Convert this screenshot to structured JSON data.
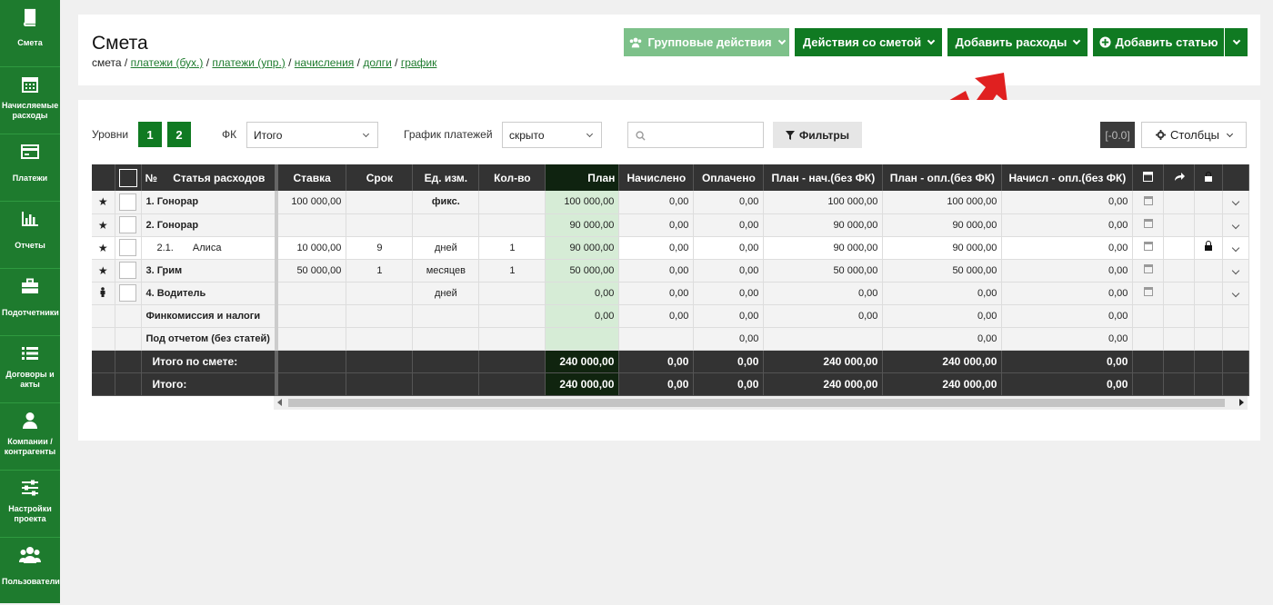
{
  "sidebar": {
    "items": [
      {
        "label": "Смета",
        "icon": "book-icon"
      },
      {
        "label": "Начисляемые расходы",
        "icon": "calendar-icon"
      },
      {
        "label": "Платежи",
        "icon": "card-icon"
      },
      {
        "label": "Отчеты",
        "icon": "bar-chart-icon"
      },
      {
        "label": "Подотчетники",
        "icon": "briefcase-icon"
      },
      {
        "label": "Договоры и акты",
        "icon": "list-icon"
      },
      {
        "label": "Компании / контрагенты",
        "icon": "user-icon"
      },
      {
        "label": "Настройки проекта",
        "icon": "sliders-icon"
      },
      {
        "label": "Пользователи",
        "icon": "users-icon"
      }
    ]
  },
  "header": {
    "title": "Смета",
    "breadcrumb_root": "смета",
    "breadcrumb_links": [
      "платежи (бух.)",
      "платежи (упр.)",
      "начисления",
      "долги",
      "график"
    ],
    "buttons": {
      "group_actions": "Групповые действия",
      "estimate_actions": "Действия со сметой",
      "add_expenses": "Добавить расходы",
      "add_item": "Добавить статью"
    }
  },
  "toolbar": {
    "levels_label": "Уровни",
    "levels": [
      "1",
      "2"
    ],
    "fk_label": "ФК",
    "fk_value": "Итого",
    "schedule_label": "График платежей",
    "schedule_value": "скрыто",
    "search_placeholder": "",
    "filters_label": "Фильтры",
    "zero_badge": "[-0.0]",
    "columns_label": "Столбцы"
  },
  "table": {
    "headers": {
      "num": "№",
      "item": "Статья расходов",
      "rate": "Ставка",
      "term": "Срок",
      "unit": "Ед. изм.",
      "qty": "Кол-во",
      "plan": "План",
      "accrued": "Начислено",
      "paid": "Оплачено",
      "plan_acc": "План - нач.(без ФК)",
      "plan_paid": "План - опл.(без ФК)",
      "acc_paid": "Начисл - опл.(без ФК)"
    },
    "rows": [
      {
        "marker": "★",
        "name": "1. Гонорар",
        "rate": "100 000,00",
        "term": "",
        "unit": "фикс.",
        "qty": "",
        "plan": "100 000,00",
        "accrued": "0,00",
        "paid": "0,00",
        "plan_acc": "100 000,00",
        "plan_paid": "100 000,00",
        "acc_paid": "0,00"
      },
      {
        "marker": "★",
        "name": "2. Гонорар",
        "rate": "",
        "term": "",
        "unit": "",
        "qty": "",
        "plan": "90 000,00",
        "accrued": "0,00",
        "paid": "0,00",
        "plan_acc": "90 000,00",
        "plan_paid": "90 000,00",
        "acc_paid": "0,00"
      },
      {
        "marker": "★",
        "sub_num": "2.1.",
        "name": "Алиса",
        "rate": "10 000,00",
        "term": "9",
        "unit": "дней",
        "qty": "1",
        "plan": "90 000,00",
        "accrued": "0,00",
        "paid": "0,00",
        "plan_acc": "90 000,00",
        "plan_paid": "90 000,00",
        "acc_paid": "0,00"
      },
      {
        "marker": "★",
        "name": "3. Грим",
        "rate": "50 000,00",
        "term": "1",
        "unit": "месяцев",
        "qty": "1",
        "plan": "50 000,00",
        "accrued": "0,00",
        "paid": "0,00",
        "plan_acc": "50 000,00",
        "plan_paid": "50 000,00",
        "acc_paid": "0,00"
      },
      {
        "marker": "person",
        "name": "4. Водитель",
        "rate": "",
        "term": "",
        "unit": "дней",
        "qty": "",
        "plan": "0,00",
        "accrued": "0,00",
        "paid": "0,00",
        "plan_acc": "0,00",
        "plan_paid": "0,00",
        "acc_paid": "0,00"
      },
      {
        "name": "Финкомиссия и налоги",
        "plan": "0,00",
        "accrued": "0,00",
        "paid": "0,00",
        "plan_acc": "0,00",
        "plan_paid": "0,00",
        "acc_paid": "0,00"
      },
      {
        "name": "Под отчетом (без статей)",
        "plan": "",
        "accrued": "",
        "paid": "0,00",
        "plan_acc": "",
        "plan_paid": "0,00",
        "acc_paid": "0,00"
      }
    ],
    "totals": [
      {
        "label": "Итого по смете:",
        "plan": "240 000,00",
        "accrued": "0,00",
        "paid": "0,00",
        "plan_acc": "240 000,00",
        "plan_paid": "240 000,00",
        "acc_paid": "0,00"
      },
      {
        "label": "Итого:",
        "plan": "240 000,00",
        "accrued": "0,00",
        "paid": "0,00",
        "plan_acc": "240 000,00",
        "plan_paid": "240 000,00",
        "acc_paid": "0,00"
      }
    ]
  },
  "colors": {
    "brand_green": "#107a22",
    "sidebar_green": "#1e7b2e",
    "arrow_red": "#e02020"
  }
}
